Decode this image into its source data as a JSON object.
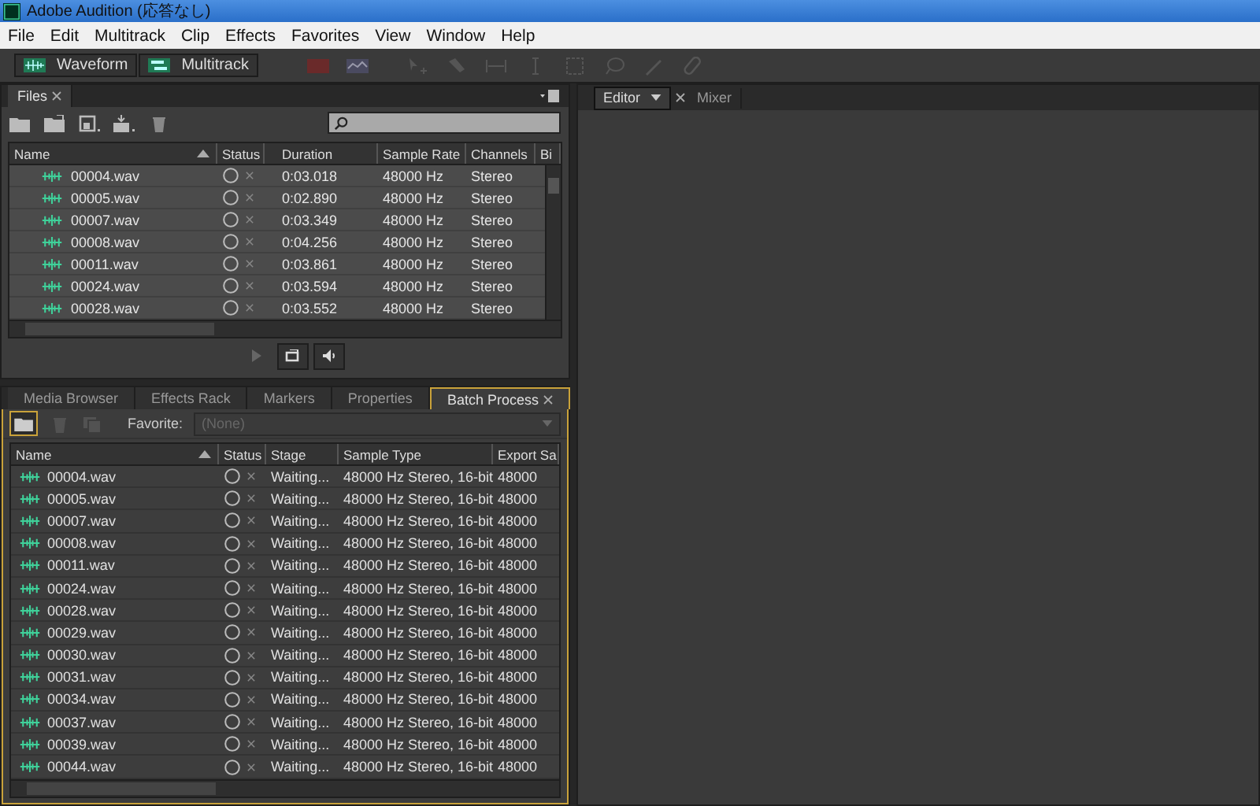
{
  "window": {
    "title": "Adobe Audition (応答なし)"
  },
  "menu": [
    "File",
    "Edit",
    "Multitrack",
    "Clip",
    "Effects",
    "Favorites",
    "View",
    "Window",
    "Help"
  ],
  "workspace_buttons": [
    {
      "label": "Waveform",
      "kind": "waveform"
    },
    {
      "label": "Multitrack",
      "kind": "multitrack"
    }
  ],
  "files_panel": {
    "tab": "Files",
    "columns": [
      "Name",
      "Status",
      "Duration",
      "Sample Rate",
      "Channels",
      "Bi"
    ],
    "rows": [
      {
        "name": "00004.wav",
        "duration": "0:03.018",
        "sample_rate": "48000 Hz",
        "channels": "Stereo"
      },
      {
        "name": "00005.wav",
        "duration": "0:02.890",
        "sample_rate": "48000 Hz",
        "channels": "Stereo"
      },
      {
        "name": "00007.wav",
        "duration": "0:03.349",
        "sample_rate": "48000 Hz",
        "channels": "Stereo"
      },
      {
        "name": "00008.wav",
        "duration": "0:04.256",
        "sample_rate": "48000 Hz",
        "channels": "Stereo"
      },
      {
        "name": "00011.wav",
        "duration": "0:03.861",
        "sample_rate": "48000 Hz",
        "channels": "Stereo"
      },
      {
        "name": "00024.wav",
        "duration": "0:03.594",
        "sample_rate": "48000 Hz",
        "channels": "Stereo"
      },
      {
        "name": "00028.wav",
        "duration": "0:03.552",
        "sample_rate": "48000 Hz",
        "channels": "Stereo"
      }
    ]
  },
  "bottom_tabs": [
    {
      "label": "Media Browser",
      "selected": false
    },
    {
      "label": "Effects Rack",
      "selected": false
    },
    {
      "label": "Markers",
      "selected": false
    },
    {
      "label": "Properties",
      "selected": false
    },
    {
      "label": "Batch Process",
      "selected": true
    }
  ],
  "batch": {
    "favorite_label": "Favorite:",
    "favorite": {
      "value": "(None)",
      "disabled": true
    },
    "columns": [
      "Name",
      "Status",
      "Stage",
      "Sample Type",
      "Export Sa"
    ],
    "rows": [
      {
        "name": "00004.wav",
        "stage": "Waiting...",
        "sample_type": "48000 Hz Stereo, 16-bit",
        "export": "48000"
      },
      {
        "name": "00005.wav",
        "stage": "Waiting...",
        "sample_type": "48000 Hz Stereo, 16-bit",
        "export": "48000"
      },
      {
        "name": "00007.wav",
        "stage": "Waiting...",
        "sample_type": "48000 Hz Stereo, 16-bit",
        "export": "48000"
      },
      {
        "name": "00008.wav",
        "stage": "Waiting...",
        "sample_type": "48000 Hz Stereo, 16-bit",
        "export": "48000"
      },
      {
        "name": "00011.wav",
        "stage": "Waiting...",
        "sample_type": "48000 Hz Stereo, 16-bit",
        "export": "48000"
      },
      {
        "name": "00024.wav",
        "stage": "Waiting...",
        "sample_type": "48000 Hz Stereo, 16-bit",
        "export": "48000"
      },
      {
        "name": "00028.wav",
        "stage": "Waiting...",
        "sample_type": "48000 Hz Stereo, 16-bit",
        "export": "48000"
      },
      {
        "name": "00029.wav",
        "stage": "Waiting...",
        "sample_type": "48000 Hz Stereo, 16-bit",
        "export": "48000"
      },
      {
        "name": "00030.wav",
        "stage": "Waiting...",
        "sample_type": "48000 Hz Stereo, 16-bit",
        "export": "48000"
      },
      {
        "name": "00031.wav",
        "stage": "Waiting...",
        "sample_type": "48000 Hz Stereo, 16-bit",
        "export": "48000"
      },
      {
        "name": "00034.wav",
        "stage": "Waiting...",
        "sample_type": "48000 Hz Stereo, 16-bit",
        "export": "48000"
      },
      {
        "name": "00037.wav",
        "stage": "Waiting...",
        "sample_type": "48000 Hz Stereo, 16-bit",
        "export": "48000"
      },
      {
        "name": "00039.wav",
        "stage": "Waiting...",
        "sample_type": "48000 Hz Stereo, 16-bit",
        "export": "48000"
      },
      {
        "name": "00044.wav",
        "stage": "Waiting...",
        "sample_type": "48000 Hz Stereo, 16-bit",
        "export": "48000"
      }
    ]
  },
  "editor_tabs": [
    {
      "label": "Editor",
      "selected": true
    },
    {
      "label": "Mixer",
      "selected": false
    }
  ]
}
